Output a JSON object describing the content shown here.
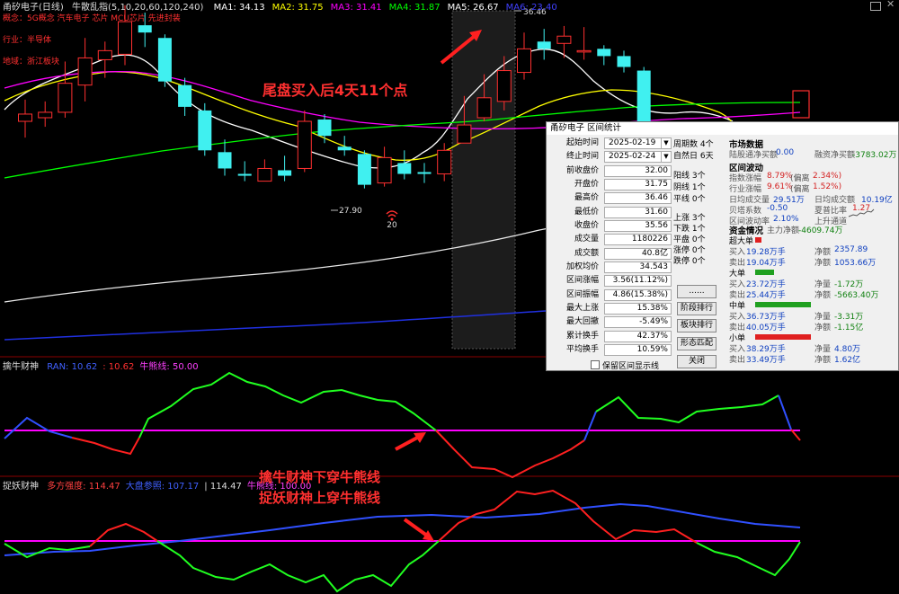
{
  "header": {
    "stock": "甬矽电子(日线)",
    "indicator": "牛散乱指(5,10,20,60,120,240)",
    "ma": [
      {
        "label": "MA1: 34.13",
        "color": "#ffffff"
      },
      {
        "label": "MA2: 31.75",
        "color": "#ffff00"
      },
      {
        "label": "MA3: 31.41",
        "color": "#ff00ff"
      },
      {
        "label": "MA4: 31.87",
        "color": "#00ff00"
      },
      {
        "label": "MA5: 26.67",
        "color": "#ffffff"
      },
      {
        "label": "MA6: 23.40",
        "color": "#4040ff"
      }
    ]
  },
  "info": {
    "concept": "概念：5G概念 汽车电子 芯片 MCU芯片 先进封装",
    "industry": "行业：半导体",
    "region": "地域：浙江板块"
  },
  "annotations": {
    "main": "尾盘买入后4天11个点",
    "price_high": "36.46",
    "price_low": "27.90",
    "day_marker": "20",
    "cross1": "擒牛财神下穿牛熊线",
    "cross2": "捉妖财神上穿牛熊线"
  },
  "panel1": {
    "name": "擒牛财神",
    "items": [
      {
        "label": "RAN: 10.62",
        "color": "#4060ff"
      },
      {
        "label": ": 10.62",
        "color": "#ff3030"
      },
      {
        "label": "牛熊线: 50.00",
        "color": "#ff40ff"
      }
    ]
  },
  "panel2": {
    "name": "捉妖财神",
    "items": [
      {
        "label": "多方强度: 114.47",
        "color": "#ff4040"
      },
      {
        "label": "大盘参照: 107.17",
        "color": "#4060ff"
      },
      {
        "label": "| 114.47",
        "color": "#dddddd"
      },
      {
        "label": "牛熊线: 100.00",
        "color": "#ff40ff"
      }
    ]
  },
  "dialog": {
    "title": "甬矽电子 区间统计",
    "fields": [
      {
        "label": "起始时间",
        "value": "2025-02-19",
        "type": "date"
      },
      {
        "label": "终止时间",
        "value": "2025-02-24",
        "type": "date"
      },
      {
        "label": "前收盘价",
        "value": "32.00"
      },
      {
        "label": "开盘价",
        "value": "31.75"
      },
      {
        "label": "最高价",
        "value": "36.46"
      },
      {
        "label": "最低价",
        "value": "31.60"
      },
      {
        "label": "收盘价",
        "value": "35.56"
      },
      {
        "label": "成交量",
        "value": "1180226"
      },
      {
        "label": "成交额",
        "value": "40.8亿"
      },
      {
        "label": "加权均价",
        "value": "34.543"
      },
      {
        "label": "区间涨幅",
        "value": "3.56(11.12%)"
      },
      {
        "label": "区间振幅",
        "value": "4.86(15.38%)"
      },
      {
        "label": "最大上涨",
        "value": "15.38%"
      },
      {
        "label": "最大回撤",
        "value": "-5.49%"
      },
      {
        "label": "累计换手",
        "value": "42.37%"
      },
      {
        "label": "平均换手",
        "value": "10.59%"
      }
    ],
    "period_stats": [
      "周期数 4个",
      "自然日 6天"
    ],
    "line_stats": [
      "阳线 3个",
      "阴线 1个",
      "平线 0个"
    ],
    "move_stats": [
      "上涨 3个",
      "下跌 1个",
      "平盘 0个",
      "涨停 0个",
      "跌停 0个"
    ],
    "buttons": [
      "......",
      "阶段排行",
      "板块排行",
      "形态匹配",
      "关闭"
    ],
    "checkbox_label": "保留区间显示线",
    "market": {
      "title": "市场数据",
      "rows": [
        [
          "陆股通净买额",
          "0.00",
          "融资净买额",
          "-3783.02万"
        ]
      ]
    },
    "range": {
      "title": "区间波动",
      "rows": [
        [
          "指数涨幅",
          "8.79%",
          "(偏离",
          "2.34%)"
        ],
        [
          "行业涨幅",
          "9.61%",
          "(偏离",
          "1.52%)"
        ],
        [
          "日均成交量",
          "29.51万",
          "日均成交额",
          "10.19亿"
        ],
        [
          "贝塔系数",
          "-0.50",
          "夏普比率",
          "1.27"
        ],
        [
          "区间波动率",
          "2.10%",
          "上升通道",
          ""
        ]
      ]
    },
    "funds": {
      "title": "资金情况",
      "main_label": "主力净额",
      "main_value": "-4609.74万",
      "groups": [
        {
          "name": "超大单",
          "bar_color": "#e02020",
          "bar_frac": 0.06,
          "buy": "19.28万手",
          "sell": "19.04万手",
          "net_buy": "2357.89",
          "net_sell": "1053.66万",
          "net_buy_label": "净额",
          "net_sell_label": "净额"
        },
        {
          "name": "大单",
          "bar_color": "#20a020",
          "bar_frac": 0.3,
          "buy": "23.72万手",
          "sell": "25.44万手",
          "net_buy": "-1.72万",
          "net_sell": "-5663.40万",
          "net_buy_label": "净量",
          "net_sell_label": "净额"
        },
        {
          "name": "中单",
          "bar_color": "#20a020",
          "bar_frac": 1.0,
          "buy": "36.73万手",
          "sell": "40.05万手",
          "net_buy": "-3.31万",
          "net_sell": "-1.15亿",
          "net_buy_label": "净量",
          "net_sell_label": "净额"
        },
        {
          "name": "小单",
          "bar_color": "#e02020",
          "bar_frac": 1.0,
          "buy": "38.29万手",
          "sell": "33.49万手",
          "net_buy": "4.80万",
          "net_sell": "1.62亿",
          "net_buy_label": "净量",
          "net_sell_label": "净额"
        }
      ],
      "buy_label": "买入",
      "sell_label": "卖出"
    }
  },
  "chart_data": {
    "type": "candlestick",
    "candles": [
      {
        "o": 31.2,
        "c": 31.6,
        "h": 32.4,
        "l": 30.3
      },
      {
        "o": 31.4,
        "c": 31.7,
        "h": 32.3,
        "l": 30.9
      },
      {
        "o": 31.7,
        "c": 33.3,
        "h": 34.5,
        "l": 31.4
      },
      {
        "o": 33.2,
        "c": 34.7,
        "h": 35.8,
        "l": 32.3
      },
      {
        "o": 34.6,
        "c": 35.1,
        "h": 35.6,
        "l": 33.6
      },
      {
        "o": 34.9,
        "c": 36.7,
        "h": 37.6,
        "l": 34.3
      },
      {
        "o": 36.5,
        "c": 36.1,
        "h": 37.2,
        "l": 35.3
      },
      {
        "o": 35.8,
        "c": 33.4,
        "h": 36.0,
        "l": 33.1
      },
      {
        "o": 33.2,
        "c": 32.0,
        "h": 33.6,
        "l": 31.5
      },
      {
        "o": 31.8,
        "c": 29.6,
        "h": 32.2,
        "l": 29.3
      },
      {
        "o": 29.5,
        "c": 28.6,
        "h": 30.2,
        "l": 28.2
      },
      {
        "o": 28.3,
        "c": 28.2,
        "h": 29.0,
        "l": 27.9
      },
      {
        "o": 27.9,
        "c": 28.6,
        "h": 29.1,
        "l": 27.9
      },
      {
        "o": 28.5,
        "c": 28.2,
        "h": 29.3,
        "l": 27.9
      },
      {
        "o": 28.6,
        "c": 31.2,
        "h": 31.8,
        "l": 28.4
      },
      {
        "o": 31.3,
        "c": 30.4,
        "h": 31.6,
        "l": 30.0
      },
      {
        "o": 29.8,
        "c": 29.6,
        "h": 30.4,
        "l": 29.3
      },
      {
        "o": 29.4,
        "c": 27.7,
        "h": 29.6,
        "l": 27.5
      },
      {
        "o": 27.8,
        "c": 29.2,
        "h": 29.8,
        "l": 27.6
      },
      {
        "o": 28.9,
        "c": 28.3,
        "h": 29.6,
        "l": 28.0
      },
      {
        "o": 28.4,
        "c": 28.3,
        "h": 28.9,
        "l": 27.8
      },
      {
        "o": 28.3,
        "c": 29.6,
        "h": 30.0,
        "l": 27.9
      },
      {
        "o": 30.0,
        "c": 31.0,
        "h": 32.6,
        "l": 30.0
      },
      {
        "o": 31.4,
        "c": 32.5,
        "h": 33.8,
        "l": 31.2
      },
      {
        "o": 32.3,
        "c": 34.0,
        "h": 34.8,
        "l": 31.8
      },
      {
        "o": 33.9,
        "c": 35.2,
        "h": 36.1,
        "l": 33.5
      },
      {
        "o": 35.6,
        "c": 35.2,
        "h": 36.3,
        "l": 34.6
      },
      {
        "o": 35.5,
        "c": 35.9,
        "h": 36.46,
        "l": 34.7
      },
      {
        "o": 35.1,
        "c": 35.1,
        "h": 36.4,
        "l": 34.6
      },
      {
        "o": 35.2,
        "c": 34.8,
        "h": 35.4,
        "l": 34.3
      },
      {
        "o": 34.8,
        "c": 34.2,
        "h": 35.1,
        "l": 33.9
      },
      {
        "o": 34.0,
        "c": 31.1,
        "h": 34.2,
        "l": 30.9
      }
    ],
    "ylim": [
      25.5,
      37.2
    ]
  }
}
